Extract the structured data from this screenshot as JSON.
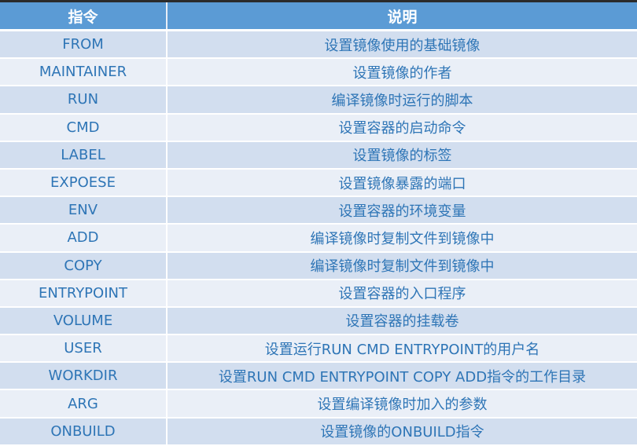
{
  "header": {
    "col1": "指令",
    "col2": "说明"
  },
  "rows": [
    {
      "cmd": "FROM",
      "desc": "设置镜像使用的基础镜像"
    },
    {
      "cmd": "MAINTAINER",
      "desc": "设置镜像的作者"
    },
    {
      "cmd": "RUN",
      "desc": "编译镜像时运行的脚本"
    },
    {
      "cmd": "CMD",
      "desc": "设置容器的启动命令"
    },
    {
      "cmd": "LABEL",
      "desc": "设置镜像的标签"
    },
    {
      "cmd": "EXPOESE",
      "desc": "设置镜像暴露的端口"
    },
    {
      "cmd": "ENV",
      "desc": "设置容器的环境变量"
    },
    {
      "cmd": "ADD",
      "desc": "编译镜像时复制文件到镜像中"
    },
    {
      "cmd": "COPY",
      "desc": "编译镜像时复制文件到镜像中"
    },
    {
      "cmd": "ENTRYPOINT",
      "desc": "设置容器的入口程序"
    },
    {
      "cmd": "VOLUME",
      "desc": "设置容器的挂载卷"
    },
    {
      "cmd": "USER",
      "desc": "设置运行RUN CMD ENTRYPOINT的用户名"
    },
    {
      "cmd": "WORKDIR",
      "desc": "设置RUN CMD ENTRYPOINT COPY ADD指令的工作目录"
    },
    {
      "cmd": "ARG",
      "desc": "设置编译镜像时加入的参数"
    },
    {
      "cmd": "ONBUILD",
      "desc": "设置镜像的ONBUILD指令"
    }
  ],
  "colors": {
    "header_bg": "#5b9bd5",
    "row_dark": "#d2deef",
    "row_light": "#eaeff7",
    "text": "#2e75b6"
  }
}
